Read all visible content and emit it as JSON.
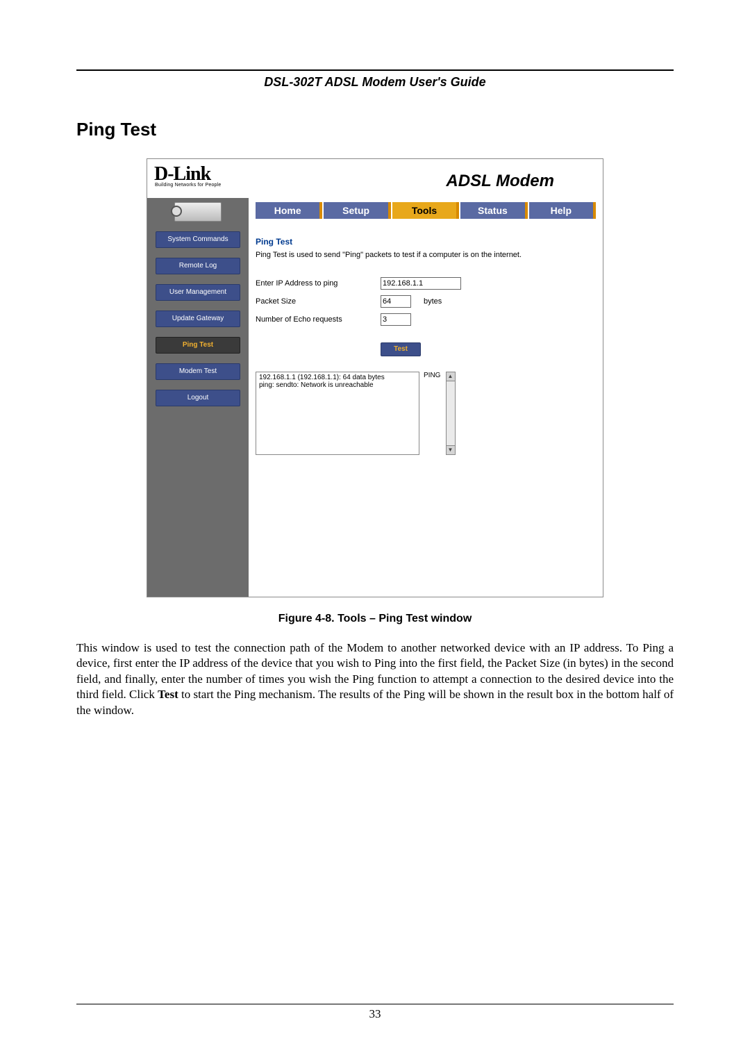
{
  "doc": {
    "header": "DSL-302T ADSL Modem User's Guide",
    "section_title": "Ping Test",
    "figure_caption": "Figure 4-8. Tools – Ping Test window",
    "body_prefix": "This window is used to test the connection path of the Modem to another networked device with an IP address. To Ping a device, first enter the IP address of the device that you wish to Ping into the first field, the Packet Size (in bytes) in the second field, and finally, enter the number of times you wish the Ping function to attempt a connection to the desired device into the third field. Click ",
    "body_bold": "Test",
    "body_suffix": " to start the Ping mechanism. The results of the Ping will be shown in the result box in the bottom half of the window.",
    "page_number": "33"
  },
  "ui": {
    "logo": "D-Link",
    "logo_tag": "Building Networks for People",
    "product": "ADSL Modem",
    "tabs": {
      "home": "Home",
      "setup": "Setup",
      "tools": "Tools",
      "status": "Status",
      "help": "Help"
    },
    "sidebar": {
      "system_commands": "System Commands",
      "remote_log": "Remote Log",
      "user_management": "User Management",
      "update_gateway": "Update Gateway",
      "ping_test": "Ping Test",
      "modem_test": "Modem Test",
      "logout": "Logout"
    },
    "content": {
      "title": "Ping Test",
      "desc": "Ping Test is used to send \"Ping\" packets to test if a computer is on the internet.",
      "label_ip": "Enter IP Address to ping",
      "value_ip": "192.168.1.1",
      "label_size": "Packet Size",
      "value_size": "64",
      "suffix_size": "bytes",
      "label_echo": "Number of Echo requests",
      "value_echo": "3",
      "test_btn": "Test",
      "result_label": "PING",
      "result_text": "192.168.1.1 (192.168.1.1): 64 data bytes\nping: sendto: Network is unreachable"
    }
  }
}
